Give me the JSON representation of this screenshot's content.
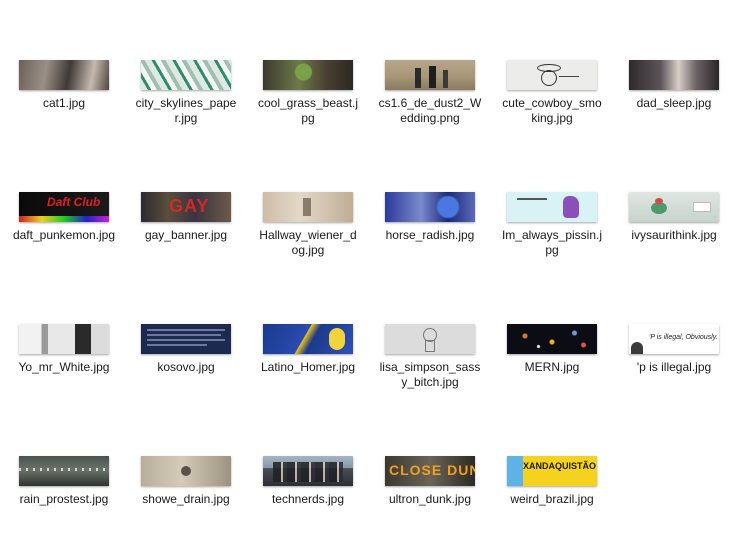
{
  "files": [
    {
      "name": "cat1.jpg"
    },
    {
      "name": "city_skylines_paper.jpg"
    },
    {
      "name": "cool_grass_beast.jpg"
    },
    {
      "name": "cs1.6_de_dust2_Wedding.png"
    },
    {
      "name": "cute_cowboy_smoking.jpg"
    },
    {
      "name": "dad_sleep.jpg"
    },
    {
      "name": "daft_punkemon.jpg",
      "thumb_text": "Daft Club"
    },
    {
      "name": "gay_banner.jpg",
      "thumb_text": "GAY"
    },
    {
      "name": "Hallway_wiener_dog.jpg"
    },
    {
      "name": "horse_radish.jpg"
    },
    {
      "name": "Im_always_pissin.jpg"
    },
    {
      "name": "ivysaurithink.jpg"
    },
    {
      "name": "Yo_mr_White.jpg"
    },
    {
      "name": "kosovo.jpg"
    },
    {
      "name": "Latino_Homer.jpg"
    },
    {
      "name": "lisa_simpson_sassy_bitch.jpg"
    },
    {
      "name": "MERN.jpg"
    },
    {
      "name": "'p is illegal.jpg",
      "thumb_text": "'P is illegal, Obviously."
    },
    {
      "name": "rain_prostest.jpg"
    },
    {
      "name": "showe_drain.jpg"
    },
    {
      "name": "technerds.jpg"
    },
    {
      "name": "ultron_dunk.jpg",
      "thumb_text": "CLOSE DUNK"
    },
    {
      "name": "weird_brazil.jpg",
      "thumb_text": "XANDAQUISTÃO"
    }
  ]
}
